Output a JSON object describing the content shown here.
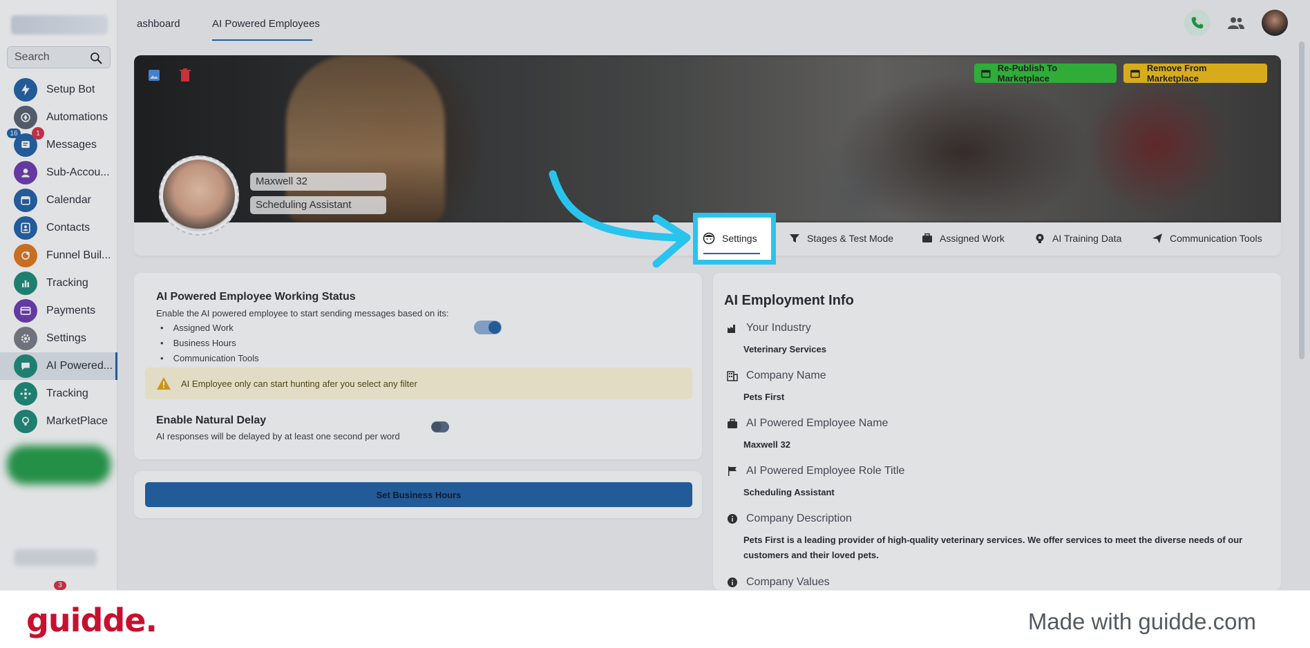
{
  "sidebar": {
    "search_placeholder": "Search",
    "items": [
      {
        "label": "Setup Bot",
        "icon": "lightning-icon",
        "color": "#2563a8"
      },
      {
        "label": "Automations",
        "icon": "automation-icon",
        "color": "#5b6472"
      },
      {
        "label": "Messages",
        "icon": "messages-icon",
        "color": "#2563a8",
        "badge_blue": "16",
        "badge_red": "1"
      },
      {
        "label": "Sub-Accou...",
        "icon": "user-icon",
        "color": "#6f3fb0"
      },
      {
        "label": "Calendar",
        "icon": "calendar-icon",
        "color": "#2563a8"
      },
      {
        "label": "Contacts",
        "icon": "contacts-icon",
        "color": "#2563a8"
      },
      {
        "label": "Funnel Buil...",
        "icon": "funnel-icon",
        "color": "#e07a1f"
      },
      {
        "label": "Tracking",
        "icon": "chart-icon",
        "color": "#1f8e7a"
      },
      {
        "label": "Payments",
        "icon": "card-icon",
        "color": "#6f3fb0"
      },
      {
        "label": "Settings",
        "icon": "gear-icon",
        "color": "#7a7f87"
      },
      {
        "label": "AI Powered...",
        "icon": "chat-icon",
        "color": "#1f8e7a"
      },
      {
        "label": "Tracking",
        "icon": "network-icon",
        "color": "#1f8e7a"
      },
      {
        "label": "MarketPlace",
        "icon": "bulb-icon",
        "color": "#1f8e7a"
      }
    ],
    "bottom_badge": "3"
  },
  "topbar": {
    "tabs": [
      "ashboard",
      "AI Powered Employees"
    ]
  },
  "banner": {
    "republish_label": "Re-Publish To Marketplace",
    "remove_label": "Remove From Marketplace",
    "employee_name": "Maxwell 32",
    "employee_role": "Scheduling Assistant"
  },
  "tabs": {
    "hidden_tab_fragment": "1",
    "settings": "Settings",
    "stages": "Stages & Test Mode",
    "assigned": "Assigned Work",
    "training": "AI Training Data",
    "comm": "Communication Tools"
  },
  "status_card": {
    "title": "AI Powered Employee Working Status",
    "description": "Enable the AI powered employee to start sending messages based on its:",
    "bullets": [
      "Assigned Work",
      "Business Hours",
      "Communication Tools"
    ],
    "working_enabled": true,
    "warning": "AI Employee only can start hunting afer you select any filter",
    "delay_title": "Enable Natural Delay",
    "delay_desc": "AI responses will be delayed by at least one second per word",
    "delay_enabled": false
  },
  "business_hours_button": "Set Business Hours",
  "info_card": {
    "title": "AI Employment Info",
    "fields": [
      {
        "label": "Your Industry",
        "value": "Veterinary Services",
        "icon": "factory-icon"
      },
      {
        "label": "Company Name",
        "value": "Pets First",
        "icon": "building-icon"
      },
      {
        "label": "AI Powered Employee Name",
        "value": "Maxwell 32",
        "icon": "briefcase-icon"
      },
      {
        "label": "AI Powered Employee Role Title",
        "value": "Scheduling Assistant",
        "icon": "flag-icon"
      },
      {
        "label": "Company Description",
        "value": "Pets First is a leading provider of high-quality veterinary services. We offer services to meet the diverse needs of our customers and their loved pets.",
        "icon": "info-icon"
      },
      {
        "label": "Company Values",
        "value": "",
        "icon": "info-icon"
      }
    ]
  },
  "footer": {
    "logo": "guidde.",
    "made_with": "Made with guidde.com"
  },
  "colors": {
    "accent": "#2563a8",
    "highlight": "#29c4ee",
    "republish_bg": "#34c23a",
    "remove_bg": "#f4c21a",
    "warning_bg": "#fff8d9",
    "brand_red": "#c8102e"
  }
}
